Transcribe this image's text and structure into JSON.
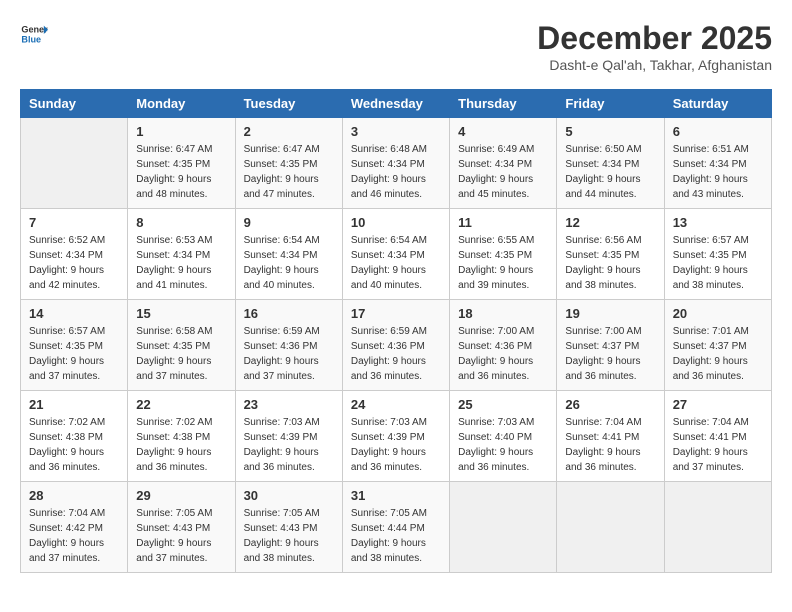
{
  "logo": {
    "line1": "General",
    "line2": "Blue"
  },
  "title": "December 2025",
  "subtitle": "Dasht-e Qal'ah, Takhar, Afghanistan",
  "days_of_week": [
    "Sunday",
    "Monday",
    "Tuesday",
    "Wednesday",
    "Thursday",
    "Friday",
    "Saturday"
  ],
  "weeks": [
    [
      {
        "day": "",
        "info": ""
      },
      {
        "day": "1",
        "info": "Sunrise: 6:47 AM\nSunset: 4:35 PM\nDaylight: 9 hours\nand 48 minutes."
      },
      {
        "day": "2",
        "info": "Sunrise: 6:47 AM\nSunset: 4:35 PM\nDaylight: 9 hours\nand 47 minutes."
      },
      {
        "day": "3",
        "info": "Sunrise: 6:48 AM\nSunset: 4:34 PM\nDaylight: 9 hours\nand 46 minutes."
      },
      {
        "day": "4",
        "info": "Sunrise: 6:49 AM\nSunset: 4:34 PM\nDaylight: 9 hours\nand 45 minutes."
      },
      {
        "day": "5",
        "info": "Sunrise: 6:50 AM\nSunset: 4:34 PM\nDaylight: 9 hours\nand 44 minutes."
      },
      {
        "day": "6",
        "info": "Sunrise: 6:51 AM\nSunset: 4:34 PM\nDaylight: 9 hours\nand 43 minutes."
      }
    ],
    [
      {
        "day": "7",
        "info": "Sunrise: 6:52 AM\nSunset: 4:34 PM\nDaylight: 9 hours\nand 42 minutes."
      },
      {
        "day": "8",
        "info": "Sunrise: 6:53 AM\nSunset: 4:34 PM\nDaylight: 9 hours\nand 41 minutes."
      },
      {
        "day": "9",
        "info": "Sunrise: 6:54 AM\nSunset: 4:34 PM\nDaylight: 9 hours\nand 40 minutes."
      },
      {
        "day": "10",
        "info": "Sunrise: 6:54 AM\nSunset: 4:34 PM\nDaylight: 9 hours\nand 40 minutes."
      },
      {
        "day": "11",
        "info": "Sunrise: 6:55 AM\nSunset: 4:35 PM\nDaylight: 9 hours\nand 39 minutes."
      },
      {
        "day": "12",
        "info": "Sunrise: 6:56 AM\nSunset: 4:35 PM\nDaylight: 9 hours\nand 38 minutes."
      },
      {
        "day": "13",
        "info": "Sunrise: 6:57 AM\nSunset: 4:35 PM\nDaylight: 9 hours\nand 38 minutes."
      }
    ],
    [
      {
        "day": "14",
        "info": "Sunrise: 6:57 AM\nSunset: 4:35 PM\nDaylight: 9 hours\nand 37 minutes."
      },
      {
        "day": "15",
        "info": "Sunrise: 6:58 AM\nSunset: 4:35 PM\nDaylight: 9 hours\nand 37 minutes."
      },
      {
        "day": "16",
        "info": "Sunrise: 6:59 AM\nSunset: 4:36 PM\nDaylight: 9 hours\nand 37 minutes."
      },
      {
        "day": "17",
        "info": "Sunrise: 6:59 AM\nSunset: 4:36 PM\nDaylight: 9 hours\nand 36 minutes."
      },
      {
        "day": "18",
        "info": "Sunrise: 7:00 AM\nSunset: 4:36 PM\nDaylight: 9 hours\nand 36 minutes."
      },
      {
        "day": "19",
        "info": "Sunrise: 7:00 AM\nSunset: 4:37 PM\nDaylight: 9 hours\nand 36 minutes."
      },
      {
        "day": "20",
        "info": "Sunrise: 7:01 AM\nSunset: 4:37 PM\nDaylight: 9 hours\nand 36 minutes."
      }
    ],
    [
      {
        "day": "21",
        "info": "Sunrise: 7:02 AM\nSunset: 4:38 PM\nDaylight: 9 hours\nand 36 minutes."
      },
      {
        "day": "22",
        "info": "Sunrise: 7:02 AM\nSunset: 4:38 PM\nDaylight: 9 hours\nand 36 minutes."
      },
      {
        "day": "23",
        "info": "Sunrise: 7:03 AM\nSunset: 4:39 PM\nDaylight: 9 hours\nand 36 minutes."
      },
      {
        "day": "24",
        "info": "Sunrise: 7:03 AM\nSunset: 4:39 PM\nDaylight: 9 hours\nand 36 minutes."
      },
      {
        "day": "25",
        "info": "Sunrise: 7:03 AM\nSunset: 4:40 PM\nDaylight: 9 hours\nand 36 minutes."
      },
      {
        "day": "26",
        "info": "Sunrise: 7:04 AM\nSunset: 4:41 PM\nDaylight: 9 hours\nand 36 minutes."
      },
      {
        "day": "27",
        "info": "Sunrise: 7:04 AM\nSunset: 4:41 PM\nDaylight: 9 hours\nand 37 minutes."
      }
    ],
    [
      {
        "day": "28",
        "info": "Sunrise: 7:04 AM\nSunset: 4:42 PM\nDaylight: 9 hours\nand 37 minutes."
      },
      {
        "day": "29",
        "info": "Sunrise: 7:05 AM\nSunset: 4:43 PM\nDaylight: 9 hours\nand 37 minutes."
      },
      {
        "day": "30",
        "info": "Sunrise: 7:05 AM\nSunset: 4:43 PM\nDaylight: 9 hours\nand 38 minutes."
      },
      {
        "day": "31",
        "info": "Sunrise: 7:05 AM\nSunset: 4:44 PM\nDaylight: 9 hours\nand 38 minutes."
      },
      {
        "day": "",
        "info": ""
      },
      {
        "day": "",
        "info": ""
      },
      {
        "day": "",
        "info": ""
      }
    ]
  ]
}
